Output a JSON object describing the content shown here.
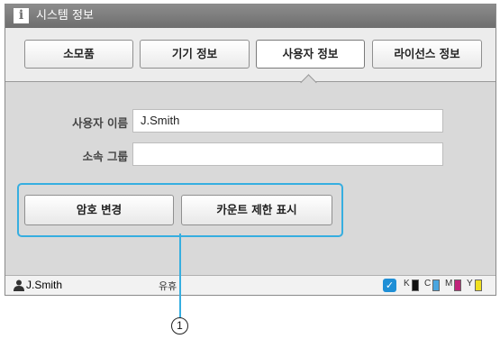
{
  "window": {
    "title": "시스템 정보",
    "icon": "info-icon"
  },
  "tabs": [
    {
      "label": "소모품",
      "active": false
    },
    {
      "label": "기기 정보",
      "active": false
    },
    {
      "label": "사용자 정보",
      "active": true
    },
    {
      "label": "라이선스 정보",
      "active": false
    }
  ],
  "fields": {
    "user_name": {
      "label": "사용자 이름",
      "value": "J.Smith"
    },
    "group": {
      "label": "소속 그룹",
      "value": ""
    }
  },
  "buttons": {
    "change_password": "암호 변경",
    "show_count_limit": "카운트 제한 표시"
  },
  "status": {
    "user": "J.Smith",
    "text": "유휴",
    "ink": [
      {
        "label": "K",
        "color": "#111111"
      },
      {
        "label": "C",
        "color": "#4aa6e0"
      },
      {
        "label": "M",
        "color": "#c0247a"
      },
      {
        "label": "Y",
        "color": "#f0e020"
      }
    ]
  },
  "callout": {
    "number": "1"
  },
  "colors": {
    "highlight": "#36aee0",
    "titlebar": "#7a7a7a"
  }
}
